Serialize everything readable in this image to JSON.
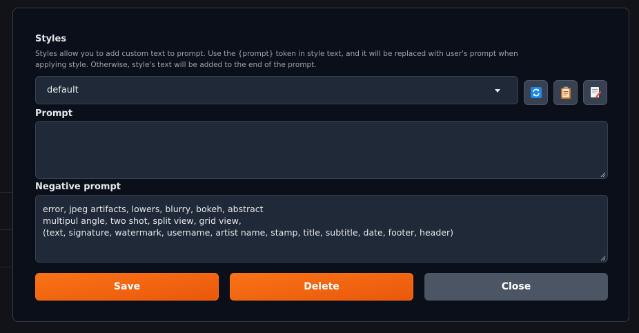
{
  "styles_modal": {
    "title": "Styles",
    "description": "Styles allow you to add custom text to prompt. Use the {prompt} token in style text, and it will be replaced with user's prompt when applying style. Otherwise, style's text will be added to the end of the prompt.",
    "style_select": {
      "value": "default"
    },
    "toolbar": {
      "refresh_icon": "refresh-icon",
      "apply_icon": "clipboard-icon",
      "copy_icon": "edit-note-icon"
    },
    "prompt": {
      "label": "Prompt",
      "value": ""
    },
    "negative_prompt": {
      "label": "Negative prompt",
      "value": "error, jpeg artifacts, lowers, blurry, bokeh, abstract\nmultipul angle, two shot, split view, grid view,\n(text, signature, watermark, username, artist name, stamp, title, subtitle, date, footer, header)"
    },
    "buttons": {
      "save_label": "Save",
      "delete_label": "Delete",
      "close_label": "Close"
    },
    "colors": {
      "accent": "#f97316",
      "accent_dark": "#ea580c",
      "panel": "#0b0f19",
      "input": "#1f2937",
      "secondary": "#4b5563"
    }
  }
}
